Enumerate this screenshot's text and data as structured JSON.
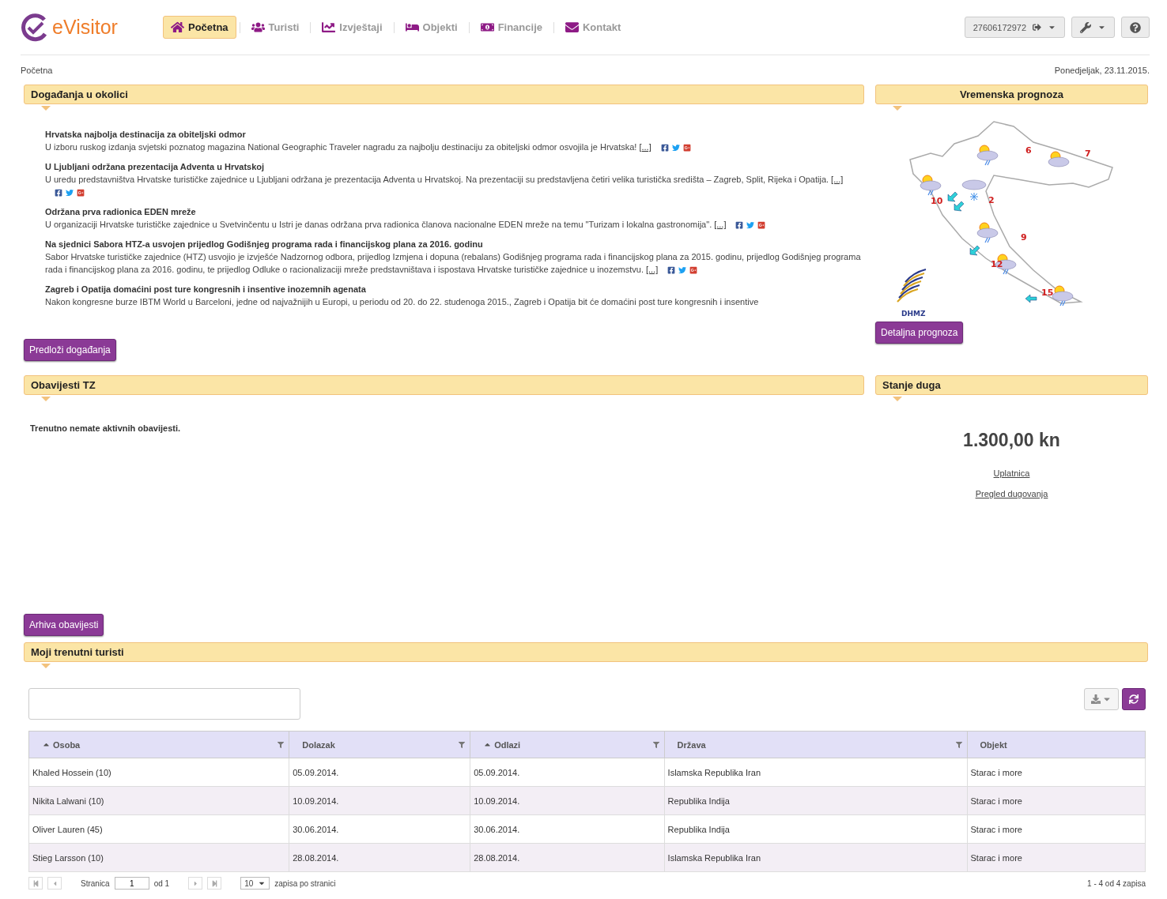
{
  "header": {
    "logo": "eVisitor",
    "nav": [
      {
        "label": "Početna",
        "selected": true
      },
      {
        "label": "Turisti",
        "selected": false
      },
      {
        "label": "Izvještaji",
        "selected": false
      },
      {
        "label": "Objekti",
        "selected": false
      },
      {
        "label": "Financije",
        "selected": false
      },
      {
        "label": "Kontakt",
        "selected": false
      }
    ],
    "user_id": "27606172972"
  },
  "breadcrumb": "Početna",
  "date": "Ponedjeljak, 23.11.2015.",
  "events": {
    "title": "Događanja u okolici",
    "items": [
      {
        "title": "Hrvatska najbolja destinacija za obiteljski odmor",
        "text": "U izboru ruskog izdanja svjetski poznatog magazina National Geographic Traveler nagradu za najbolju destinaciju za obiteljski odmor osvojila je Hrvatska!",
        "more": "[...]",
        "social": true
      },
      {
        "title": "U Ljubljani održana prezentacija Adventa u Hrvatskoj",
        "text": "U uredu predstavništva Hrvatske turističke zajednice u Ljubljani održana je prezentacija Adventa u Hrvatskoj. Na prezentaciji su predstavljena četiri velika turistička središta – Zagreb, Split, Rijeka i Opatija.",
        "more": "[...]",
        "social": true
      },
      {
        "title": "Održana prva radionica EDEN mreže",
        "text": "U organizaciji Hrvatske turističke zajednice u Svetvinčentu u Istri je danas održana prva radionica članova nacionalne EDEN mreže na temu \"Turizam i lokalna gastronomija\".",
        "more": "[...]",
        "social": true
      },
      {
        "title": "Na sjednici Sabora HTZ-a usvojen prijedlog Godišnjeg programa rada i financijskog plana za 2016. godinu",
        "text": "Sabor Hrvatske turističke zajednice (HTZ) usvojio je izvješće Nadzornog odbora, prijedlog Izmjena i dopuna (rebalans) Godišnjeg programa rada i financijskog plana za 2015. godinu, prijedlog Godišnjeg programa rada i financijskog plana za 2016. godinu, te prijedlog Odluke o racionalizaciji mreže predstavništava i ispostava Hrvatske turističke zajednice u inozemstvu.",
        "more": "[...]",
        "social": true
      },
      {
        "title": "Zagreb i Opatija domaćini post ture kongresnih i insentive inozemnih agenata",
        "text": "Nakon kongresne burze IBTM World u Barceloni, jedne od najvažnijih u Europi, u periodu od 20. do 22. studenoga 2015., Zagreb i Opatija bit će domaćini post ture kongresnih i insentive",
        "social": false
      }
    ],
    "button": "Predloži događanja"
  },
  "weather": {
    "title": "Vremenska prognoza",
    "temperatures": [
      "6",
      "7",
      "2",
      "10",
      "9",
      "12",
      "15"
    ],
    "logo_text": "DHMZ",
    "button": "Detaljna prognoza"
  },
  "notices": {
    "title": "Obavijesti TZ",
    "message": "Trenutno nemate aktivnih obavijesti.",
    "button": "Arhiva obavijesti"
  },
  "debt": {
    "title": "Stanje duga",
    "amount": "1.300,00 kn",
    "links": [
      "Uplatnica",
      "Pregled dugovanja"
    ]
  },
  "tourists": {
    "title": "Moji trenutni turisti",
    "columns": [
      {
        "label": "Osoba",
        "sorted": true,
        "filterable": true
      },
      {
        "label": "Dolazak",
        "sorted": false,
        "filterable": true
      },
      {
        "label": "Odlazi",
        "sorted": true,
        "filterable": true
      },
      {
        "label": "Država",
        "sorted": false,
        "filterable": true
      },
      {
        "label": "Objekt",
        "sorted": false,
        "filterable": false
      }
    ],
    "rows": [
      [
        "Khaled Hossein (10)",
        "05.09.2014.",
        "05.09.2014.",
        "Islamska Republika Iran",
        "Starac i more"
      ],
      [
        "Nikita Lalwani (10)",
        "10.09.2014.",
        "10.09.2014.",
        "Republika Indija",
        "Starac i more"
      ],
      [
        "Oliver Lauren (45)",
        "30.06.2014.",
        "30.06.2014.",
        "Republika Indija",
        "Starac i more"
      ],
      [
        "Stieg Larsson (10)",
        "28.08.2014.",
        "28.08.2014.",
        "Islamska Republika Iran",
        "Starac i more"
      ]
    ],
    "pager": {
      "page_label": "Stranica",
      "page": "1",
      "of": "od 1",
      "page_size": "10",
      "page_size_label": "zapisa po stranici",
      "summary": "1 - 4 od 4 zapisa"
    }
  }
}
